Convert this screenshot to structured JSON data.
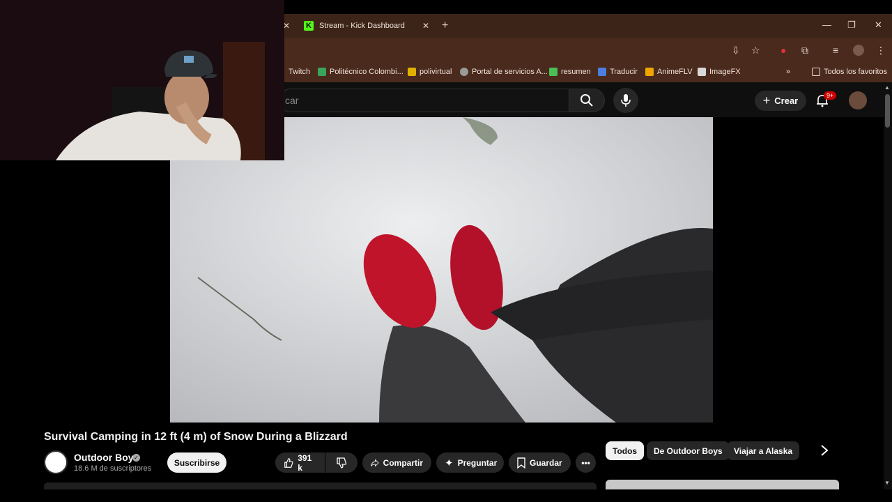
{
  "browser": {
    "active_tab_title": "Stream - Kick Dashboard",
    "bookmarks": [
      {
        "label": "Twitch"
      },
      {
        "label": "Politécnico Colombi..."
      },
      {
        "label": "polivirtual"
      },
      {
        "label": "Portal de servicios A..."
      },
      {
        "label": "resumen"
      },
      {
        "label": "Traducir"
      },
      {
        "label": "AnimeFLV"
      },
      {
        "label": "ImageFX"
      }
    ],
    "all_bookmarks_label": "Todos los favoritos"
  },
  "youtube": {
    "search_placeholder": "car",
    "create_label": "Crear",
    "notifications_badge": "9+",
    "video": {
      "title": "Survival Camping in 12 ft (4 m) of Snow During a Blizzard",
      "channel_name": "Outdoor Boys",
      "subscribers": "18.6 M de suscriptores",
      "subscribe_label": "Suscribirse",
      "likes": "391 k",
      "share_label": "Compartir",
      "ask_label": "Preguntar",
      "save_label": "Guardar"
    },
    "chips": [
      "Todos",
      "De Outdoor Boys",
      "Viajar a Alaska"
    ]
  },
  "colors": {
    "browser_frame": "#3c2418",
    "kick_green": "#53fc18",
    "yt_background": "#0f0f0f",
    "notification_red": "#cc0000",
    "shoe_red": "#c0142a"
  }
}
